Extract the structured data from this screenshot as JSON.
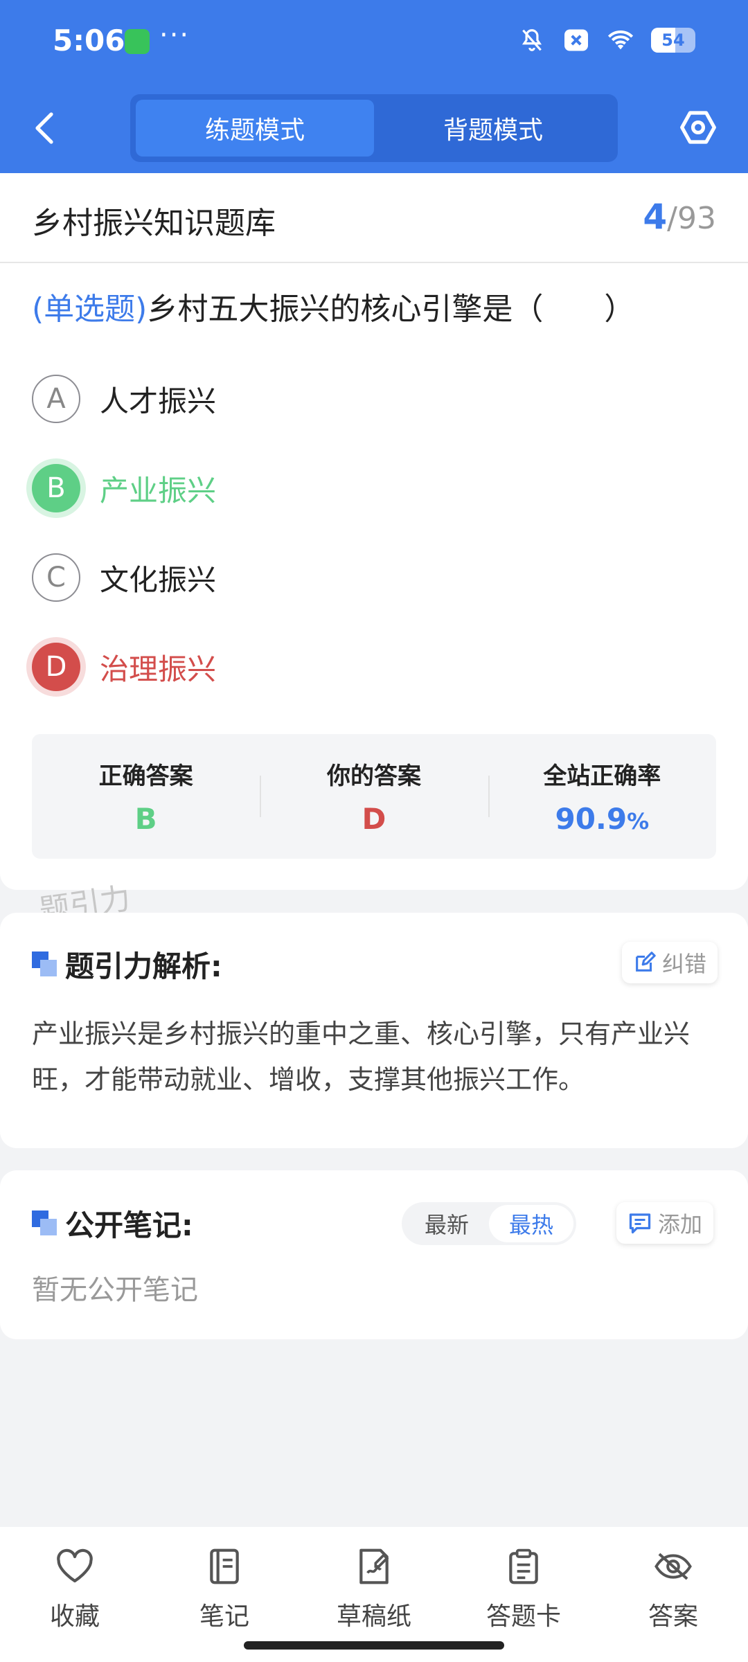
{
  "status_bar": {
    "time": "5:06",
    "battery": "54",
    "more": "···",
    "icons": [
      "wechat-icon",
      "mute-icon",
      "notification-x-icon",
      "wifi-icon",
      "battery-icon"
    ]
  },
  "header": {
    "modes": [
      {
        "label": "练题模式",
        "active": true
      },
      {
        "label": "背题模式",
        "active": false
      }
    ],
    "accent": "#3d7bea"
  },
  "bank": {
    "title": "乡村振兴知识题库",
    "current": "4",
    "separator": "/",
    "total": "93"
  },
  "question": {
    "type": "(单选题)",
    "text": "乡村五大振兴的核心引擎是（　　）",
    "options": [
      {
        "letter": "A",
        "text": "人才振兴",
        "state": "normal"
      },
      {
        "letter": "B",
        "text": "产业振兴",
        "state": "correct"
      },
      {
        "letter": "C",
        "text": "文化振兴",
        "state": "normal"
      },
      {
        "letter": "D",
        "text": "治理振兴",
        "state": "wrong"
      }
    ]
  },
  "answer": {
    "correct_label": "正确答案",
    "correct_value": "B",
    "yours_label": "你的答案",
    "yours_value": "D",
    "rate_label": "全站正确率",
    "rate_value": "90.9",
    "rate_unit": "%"
  },
  "watermark": "题引力",
  "analysis": {
    "title": "题引力解析:",
    "report_label": "纠错",
    "text": "产业振兴是乡村振兴的重中之重、核心引擎，只有产业兴旺，才能带动就业、增收，支撑其他振兴工作。"
  },
  "notes": {
    "title": "公开笔记:",
    "sort_options": [
      {
        "label": "最新",
        "active": false
      },
      {
        "label": "最热",
        "active": true
      }
    ],
    "add_label": "添加",
    "empty_text": "暂无公开笔记"
  },
  "bottom_nav": [
    {
      "label": "收藏",
      "icon": "heart-icon"
    },
    {
      "label": "笔记",
      "icon": "notebook-icon"
    },
    {
      "label": "草稿纸",
      "icon": "draft-icon"
    },
    {
      "label": "答题卡",
      "icon": "clipboard-icon"
    },
    {
      "label": "答案",
      "icon": "eye-off-icon"
    }
  ],
  "colors": {
    "correct": "#5ecf86",
    "wrong": "#d34d4b",
    "primary": "#3d7bea"
  }
}
